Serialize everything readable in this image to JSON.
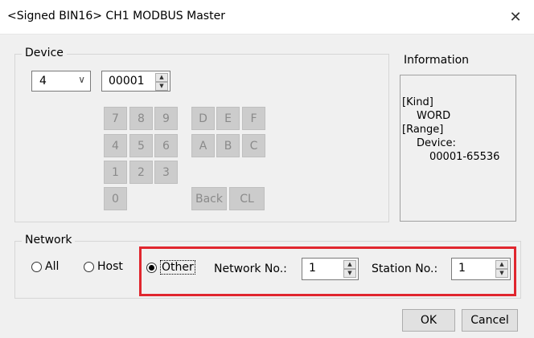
{
  "window": {
    "title": "<Signed BIN16> CH1 MODBUS Master",
    "close_glyph": "✕"
  },
  "device": {
    "group_label": "Device",
    "type_value": "4",
    "address_value": "00001",
    "keys": [
      "7",
      "8",
      "9",
      "D",
      "E",
      "F",
      "4",
      "5",
      "6",
      "A",
      "B",
      "C",
      "1",
      "2",
      "3",
      "0",
      "Back",
      "CL"
    ]
  },
  "information": {
    "label": "Information",
    "lines": [
      "[Kind]",
      "WORD",
      "[Range]",
      "Device:",
      "00001-65536"
    ]
  },
  "network": {
    "group_label": "Network",
    "options": [
      "All",
      "Host",
      "Other"
    ],
    "selected": "Other",
    "network_no_label": "Network No.:",
    "network_no_value": "1",
    "station_no_label": "Station No.:",
    "station_no_value": "1"
  },
  "buttons": {
    "ok": "OK",
    "cancel": "Cancel"
  },
  "colors": {
    "highlight": "#e0262e"
  }
}
